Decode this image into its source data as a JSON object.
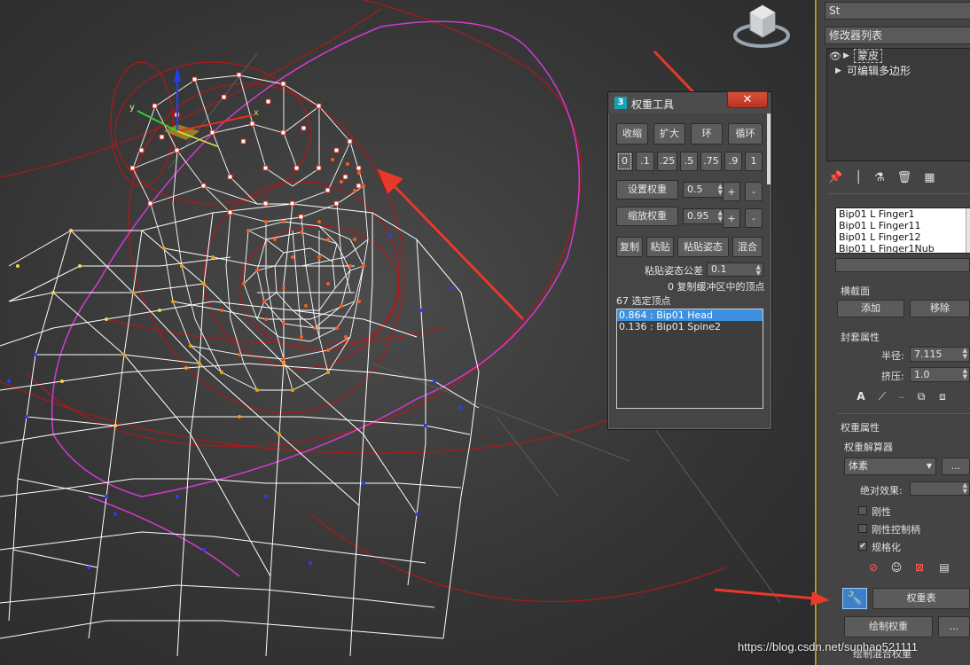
{
  "panel": {
    "name_field": "St",
    "modifier_list_label": "修改器列表",
    "modifier_stack": [
      {
        "label": "蒙皮"
      },
      {
        "label": "可编辑多边形"
      }
    ],
    "bones": [
      "Bip01 L Finger1",
      "Bip01 L Finger11",
      "Bip01 L Finger12",
      "Bip01 L Finger1Nub"
    ],
    "cross_section": {
      "title": "横截面",
      "add": "添加",
      "remove": "移除"
    },
    "envelope": {
      "title": "封套属性",
      "radius_label": "半径:",
      "radius_value": "7.115",
      "squash_label": "挤压:",
      "squash_value": "1.0",
      "a_label": "A"
    },
    "weight_props": {
      "title": "权重属性",
      "solver_label": "权重解算器",
      "solver_value": "体素",
      "solver_more": "...",
      "absolute_label": "绝对效果:",
      "rigid": "刚性",
      "rigid_handles": "刚性控制柄",
      "normalize": "规格化",
      "weight_table": "权重表",
      "paint_weights": "绘制权重",
      "paint_more": "...",
      "bottom_partial": "绘制混合权重"
    }
  },
  "dialog": {
    "icon": "3",
    "title": "权重工具",
    "close": "✕",
    "row1": [
      "收缩",
      "扩大",
      "环",
      "循环"
    ],
    "presets": [
      "0",
      ".1",
      ".25",
      ".5",
      ".75",
      ".9",
      "1"
    ],
    "set_weight": "设置权重",
    "set_weight_value": "0.5",
    "scale_weight": "缩放权重",
    "scale_weight_value": "0.95",
    "plus": "+",
    "minus": "-",
    "row_copy": [
      "复制",
      "粘贴",
      "粘贴姿态",
      "混合"
    ],
    "paste_tolerance_label": "粘贴姿态公差",
    "paste_tolerance_value": "0.1",
    "buffer_text": "0 复制缓冲区中的顶点",
    "selected_text": "67 选定顶点",
    "vertex_weights": [
      {
        "label": "0.864 : Bip01 Head"
      },
      {
        "label": "0.136 : Bip01 Spine2"
      }
    ]
  },
  "watermark": "https://blog.csdn.net/sunhao521111",
  "colors": {
    "annotation_arrow": "#e8392a",
    "envelope_red": "#c01a1a",
    "envelope_magenta": "#d23ad2",
    "wire_white": "#ffffff",
    "selected_vertex": "#ff5a1e",
    "accent_border": "#b8962e"
  }
}
